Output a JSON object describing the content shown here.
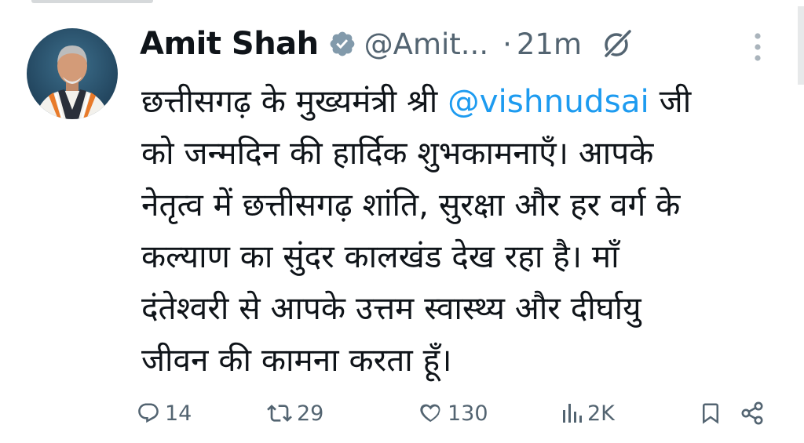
{
  "tweet": {
    "author_name": "Amit Shah",
    "handle": "@Amit...",
    "separator": "·",
    "time": "21m",
    "body": {
      "line1_pre": "छत्तीसगढ़ के मुख्यमंत्री श्री ",
      "mention": "@vishnudsai",
      "line1_post": " जी",
      "line2": "को जन्मदिन की हार्दिक शुभकामनाएँ। आपके",
      "line3": "नेतृत्व में छत्तीसगढ़ शांति, सुरक्षा और हर वर्ग के",
      "line4": "कल्याण का सुंदर कालखंड देख रहा है। माँ",
      "line5": "दंतेश्वरी से आपके उत्तम स्वास्थ्य और दीर्घायु",
      "line6": "जीवन की कामना करता हूँ।"
    },
    "actions": {
      "replies": "14",
      "reposts": "29",
      "likes": "130",
      "views": "2K"
    }
  },
  "icons": {
    "verified": "verified-badge-icon",
    "grok": "grok-icon",
    "more": "more-vertical-icon",
    "reply": "reply-icon",
    "repost": "repost-icon",
    "like": "heart-icon",
    "views": "views-icon",
    "bookmark": "bookmark-icon",
    "share": "share-icon"
  },
  "colors": {
    "text": "#0f1419",
    "secondary": "#536471",
    "mention": "#1d9bf0",
    "verified_badge": "#829aab"
  }
}
